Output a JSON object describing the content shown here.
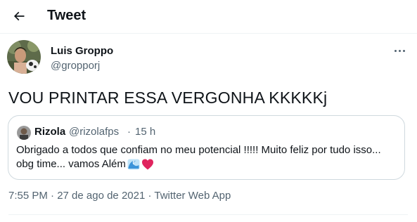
{
  "header": {
    "title": "Tweet",
    "back_icon": "arrow-left-icon"
  },
  "tweet": {
    "author_name": "Luis Groppo",
    "author_handle": "@gropporj",
    "text": "VOU PRINTAR ESSA VERGONHA KKKKKj",
    "timestamp": "7:55 PM · 27 de ago de 2021 · Twitter Web App"
  },
  "quote": {
    "author_name": "Rizola",
    "author_handle": "@rizolafps",
    "separator": "·",
    "time": "15 h",
    "line1": "Obrigado a todos que confiam no meu potencial !!!!! Muito feliz por tudo isso...",
    "line2": "obg time... vamos Além",
    "emojis": [
      "water-wave-icon",
      "red-heart-icon"
    ]
  },
  "colors": {
    "text": "#0f1419",
    "secondary": "#536471",
    "border": "#cfd9de",
    "heart": "#e0245e",
    "wave": "#3b94d9"
  }
}
